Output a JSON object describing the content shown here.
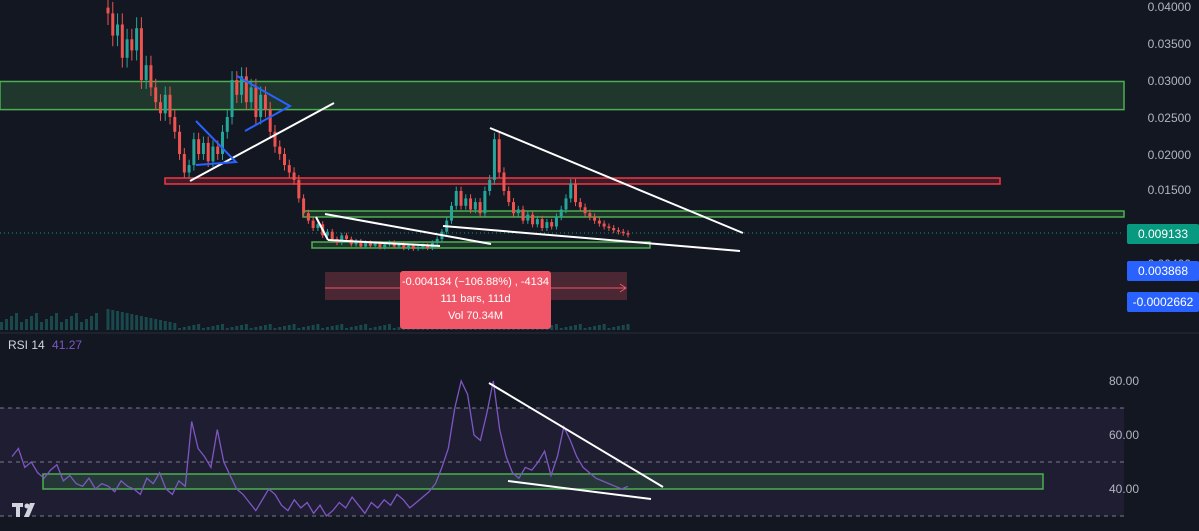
{
  "colors": {
    "background": "#131722",
    "up": "#26a69a",
    "down": "#ef5350",
    "green_zone": "#4caf50",
    "red_zone": "#f23645",
    "rsi_line": "#7e57c2",
    "price_tag": "#089981",
    "blue_tag": "#2962ff",
    "measure": "#f05668"
  },
  "price_axis": {
    "ticks": [
      "0.04000",
      "0.03500",
      "0.03000",
      "0.02500",
      "0.02000",
      "0.01500",
      "0.00400"
    ]
  },
  "price_tags": {
    "last_price": "0.009133",
    "blue_1": "0.003868",
    "blue_2": "-0.0002662"
  },
  "measure_box": {
    "line1": "-0.004134 (−106.88%) , -4134",
    "line2": "111 bars, 111d",
    "line3": "Vol 70.34M"
  },
  "rsi": {
    "name": "RSI 14",
    "value": "41.27",
    "ticks": [
      "80.00",
      "60.00",
      "40.00"
    ]
  },
  "chart_data": [
    {
      "type": "candlestick",
      "title": "",
      "ylim": [
        0.0,
        0.0405
      ],
      "x": [
        1,
        2,
        3,
        4,
        5,
        6,
        7,
        8,
        9,
        10,
        11,
        12,
        13,
        14,
        15,
        16,
        17,
        18,
        19,
        20,
        21,
        22,
        23,
        24,
        25,
        26,
        27,
        28,
        29,
        30,
        31,
        32,
        33,
        34,
        35,
        36,
        37,
        38,
        39,
        40,
        41,
        42,
        43,
        44,
        45,
        46,
        47,
        48,
        49,
        50,
        51,
        52,
        53,
        54,
        55,
        56,
        57,
        58,
        59,
        60,
        61,
        62,
        63,
        64,
        65,
        66,
        67,
        68,
        69,
        70,
        71,
        72,
        73,
        74,
        75,
        76,
        77,
        78,
        79,
        80,
        81,
        82,
        83,
        84,
        85,
        86,
        87,
        88,
        89,
        90,
        91,
        92,
        93,
        94,
        95,
        96,
        97,
        98,
        99,
        100,
        101,
        102,
        103,
        104,
        105,
        106,
        107,
        108,
        109,
        110,
        111,
        112,
        113,
        114,
        115,
        116,
        117,
        118,
        119,
        120,
        121,
        122,
        123,
        124,
        125,
        126,
        127,
        128,
        129,
        130
      ],
      "close": [
        0.039,
        0.036,
        0.0375,
        0.033,
        0.0355,
        0.034,
        0.037,
        0.03,
        0.032,
        0.029,
        0.027,
        0.0255,
        0.028,
        0.025,
        0.023,
        0.02,
        0.0175,
        0.0185,
        0.022,
        0.02,
        0.0215,
        0.019,
        0.021,
        0.02,
        0.023,
        0.025,
        0.03,
        0.028,
        0.0305,
        0.027,
        0.029,
        0.025,
        0.028,
        0.026,
        0.023,
        0.021,
        0.02,
        0.0185,
        0.0175,
        0.0165,
        0.014,
        0.012,
        0.011,
        0.01,
        0.0105,
        0.009,
        0.0095,
        0.0085,
        0.008,
        0.009,
        0.0085,
        0.0078,
        0.0082,
        0.0075,
        0.008,
        0.0076,
        0.0079,
        0.0074,
        0.0078,
        0.008,
        0.0075,
        0.0078,
        0.0073,
        0.0076,
        0.0072,
        0.0074,
        0.0076,
        0.0073,
        0.008,
        0.0085,
        0.0095,
        0.011,
        0.013,
        0.015,
        0.013,
        0.014,
        0.0125,
        0.0135,
        0.012,
        0.015,
        0.0165,
        0.022,
        0.0175,
        0.015,
        0.0135,
        0.012,
        0.0125,
        0.011,
        0.0118,
        0.0105,
        0.0112,
        0.01,
        0.0108,
        0.0102,
        0.0115,
        0.0125,
        0.014,
        0.016,
        0.0135,
        0.0128,
        0.012,
        0.0115,
        0.011,
        0.0106,
        0.0102,
        0.01,
        0.0097,
        0.0095,
        0.0093,
        0.0091
      ],
      "trendlines": "white wedge / triangle lines, blue triangle pattern, green and red horizontal zones"
    },
    {
      "type": "line",
      "name": "RSI 14",
      "ylim": [
        28,
        92
      ],
      "levels": [
        70,
        50,
        30
      ],
      "values": [
        52,
        55,
        48,
        50,
        46,
        44,
        47,
        49,
        43,
        45,
        42,
        41,
        44,
        40,
        42,
        41,
        39,
        43,
        41,
        40,
        38,
        44,
        42,
        46,
        40,
        38,
        43,
        41,
        65,
        55,
        52,
        48,
        62,
        50,
        45,
        40,
        38,
        35,
        32,
        36,
        40,
        38,
        34,
        32,
        36,
        33,
        35,
        31,
        34,
        30,
        32,
        35,
        33,
        37,
        34,
        31,
        35,
        33,
        36,
        34,
        38,
        36,
        33,
        35,
        37,
        39,
        42,
        48,
        55,
        70,
        80,
        75,
        60,
        58,
        68,
        80,
        62,
        52,
        46,
        44,
        48,
        47,
        50,
        54,
        45,
        52,
        63,
        58,
        52,
        48,
        46,
        44,
        43,
        42,
        41,
        40,
        41
      ]
    }
  ]
}
